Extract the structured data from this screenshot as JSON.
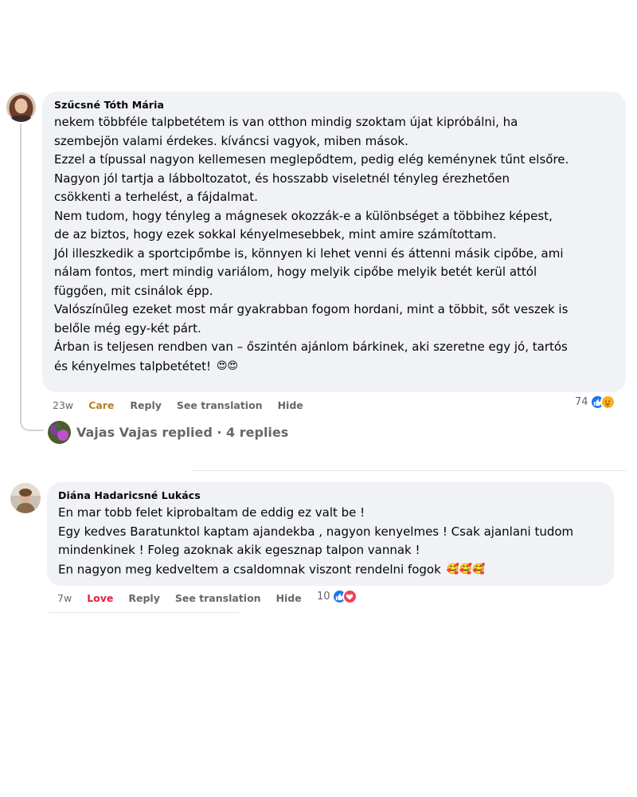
{
  "comments": [
    {
      "author": "Szűcsné Tóth Mária",
      "lines": [
        "nekem többféle talpbetétem is van otthon mindig szoktam újat kipróbálni, ha",
        "szembejön valami érdekes. kíváncsi vagyok, miben mások.",
        "Ezzel a típussal nagyon kellemesen meglepődtem, pedig elég keménynek tűnt elsőre.",
        "Nagyon jól tartja a lábboltozatot, és hosszabb viseletnél tényleg érezhetően",
        "csökkenti a terhelést, a fájdalmat.",
        "Nem tudom, hogy tényleg a mágnesek okozzák-e a különbséget a többihez képest,",
        "de az biztos, hogy ezek sokkal kényelmesebbek, mint amire számítottam.",
        "Jól illeszkedik a sportcipőmbe is, könnyen ki lehet venni és áttenni másik cipőbe, ami",
        "nálam fontos, mert mindig variálom, hogy melyik cipőbe melyik betét kerül attól",
        "függően, mit csinálok épp.",
        "Valószínűleg ezeket most már gyakrabban fogom hordani, mint a többit, sőt veszek is",
        "belőle még egy-két párt.",
        "Árban is teljesen rendben van – őszintén ajánlom bárkinek, aki szeretne egy jó, tartós",
        "és kényelmes talpbetétet!"
      ],
      "trailing_emoji": "😍😍",
      "time": "23w",
      "reaction_label": "Care",
      "reply_label": "Reply",
      "translate_label": "See translation",
      "hide_label": "Hide",
      "reaction_count": "74",
      "reaction_color": "#b4821f",
      "replies_text": "Vajas Vajas replied · 4 replies"
    },
    {
      "author": "Diána Hadaricsné Lukács",
      "lines": [
        "En mar tobb felet kiprobaltam de eddig ez valt be !",
        "Egy kedves Baratunktol kaptam ajandekba , nagyon kenyelmes ! Csak ajanlani tudom",
        "mindenkinek ! Foleg azoknak akik egesznap talpon vannak !",
        "En nagyon meg kedveltem a csaldomnak viszont rendelni fogok"
      ],
      "trailing_emoji": "🥰🥰🥰",
      "time": "7w",
      "reaction_label": "Love",
      "reply_label": "Reply",
      "translate_label": "See translation",
      "hide_label": "Hide",
      "reaction_count": "10",
      "reaction_color": "#e41e3f"
    }
  ],
  "colors": {
    "bubble_bg": "#f0f2f5",
    "secondary_text": "#65676b",
    "like_blue": "#1877f2",
    "love_red": "#f33e58",
    "care_yellow": "#f7b125"
  },
  "icons": {
    "like": "thumbs-up-icon",
    "love": "heart-icon",
    "care": "care-hug-icon"
  }
}
